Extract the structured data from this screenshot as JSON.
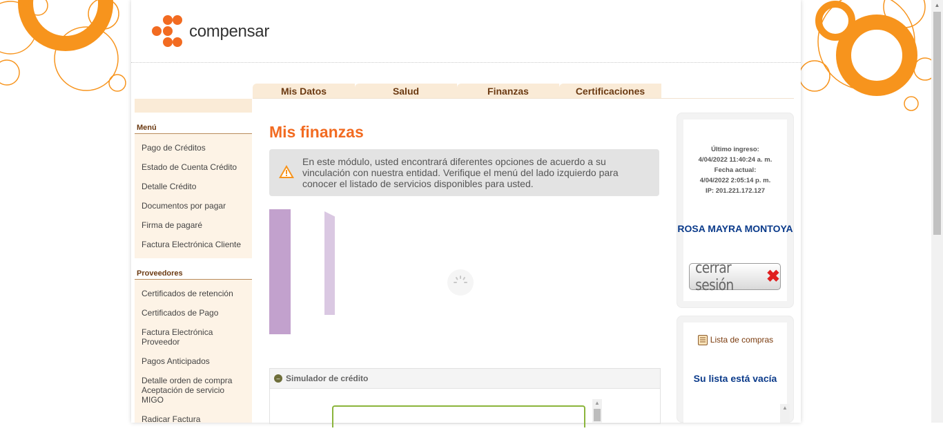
{
  "brand": {
    "name": "compensar",
    "accent": "#f26b21"
  },
  "tabs": [
    {
      "label": "Mis Datos"
    },
    {
      "label": "Salud"
    },
    {
      "label": "Finanzas"
    },
    {
      "label": "Certificaciones"
    }
  ],
  "sidebar": {
    "menu_title": "Menú",
    "menu_items": [
      {
        "label": "Pago de Créditos"
      },
      {
        "label": "Estado de Cuenta Crédito"
      },
      {
        "label": "Detalle Crédito"
      },
      {
        "label": "Documentos por pagar"
      },
      {
        "label": "Firma de pagaré"
      },
      {
        "label": "Factura Electrónica Cliente"
      }
    ],
    "providers_title": "Proveedores",
    "provider_items": [
      {
        "label": "Certificados de retención"
      },
      {
        "label": "Certificados de Pago"
      },
      {
        "label": "Factura Electrónica Proveedor"
      },
      {
        "label": "Pagos Anticipados"
      },
      {
        "label": "Detalle orden de compra Aceptación de servicio MIGO"
      },
      {
        "label": "Radicar Factura"
      }
    ]
  },
  "main": {
    "title": "Mis finanzas",
    "notice": "En este módulo, usted encontrará diferentes opciones de acuerdo a su vinculación con nuestra entidad. Verifique el menú del lado izquierdo para conocer el listado de servicios disponibles para usted.",
    "simulator_label": "Simulador de crédito"
  },
  "session": {
    "last_login_label": "Último ingreso:",
    "last_login_value": "4/04/2022 11:40:24 a. m.",
    "current_date_label": "Fecha actual:",
    "current_date_value": "4/04/2022 2:05:14 p. m.",
    "ip": "IP: 201.221.172.127",
    "user_name": "ROSA MAYRA MONTOYA",
    "logout_label": "cerrar sesión"
  },
  "cart": {
    "link_label": "Lista de compras",
    "empty_text": "Su lista está vacía"
  }
}
